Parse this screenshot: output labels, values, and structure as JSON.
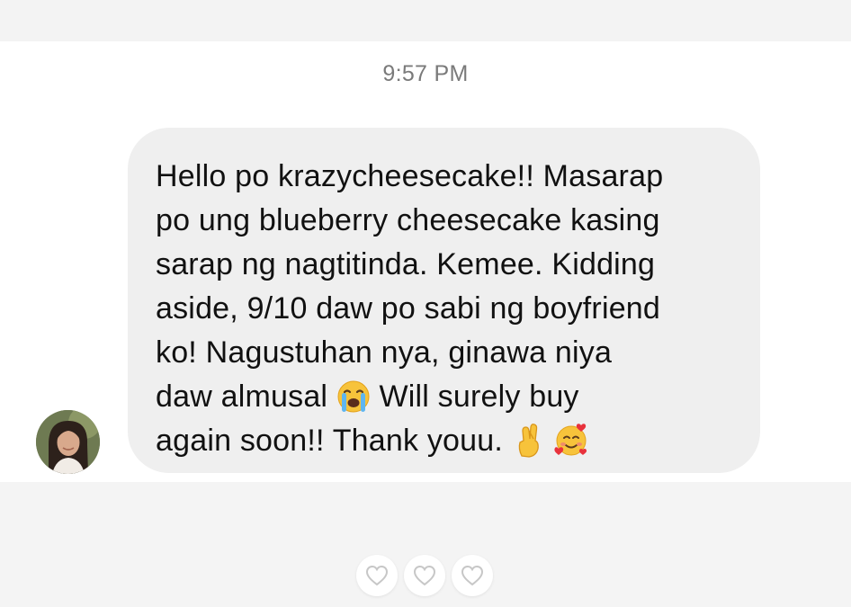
{
  "conversation": {
    "timestamp": "9:57 PM"
  },
  "message": {
    "text_part1": "Hello po krazycheesecake!! Masarap\npo ung blueberry cheesecake kasing\nsarap ng nagtitinda. Kemee. Kidding\naside, 9/10 daw po sabi ng boyfriend\nko! Nagustuhan nya, ginawa niya\ndaw almusal ",
    "emoji_1": "crying-face-emoji",
    "text_part2": " Will surely buy\nagain soon!! Thank youu. ",
    "emoji_2": "crossed-fingers-emoji",
    "emoji_3": "smiling-face-with-hearts-emoji"
  },
  "sender": {
    "avatar_icon": "profile-photo-avatar"
  },
  "reactions": [
    {
      "icon": "heart-outline-icon"
    },
    {
      "icon": "heart-outline-icon"
    },
    {
      "icon": "heart-outline-icon"
    }
  ],
  "colors": {
    "bubble": "#efefef",
    "chat_background": "#ffffff",
    "outer_background": "#f4f4f4",
    "timestamp_text": "#7a7a7a",
    "message_text": "#111111"
  }
}
